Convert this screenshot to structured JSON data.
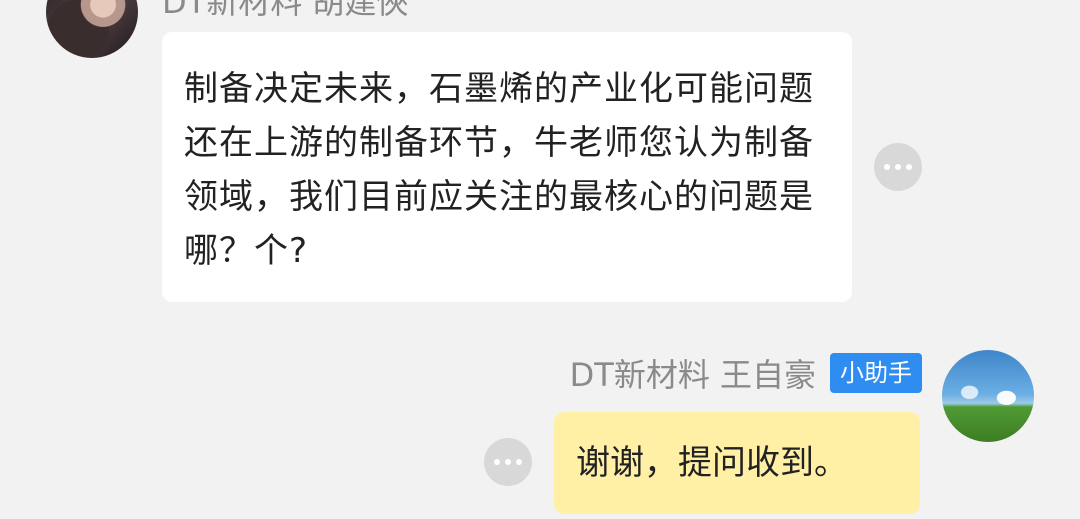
{
  "messages": [
    {
      "sender": "DT新材料 胡建俠",
      "text": "制备决定未来，石墨烯的产业化可能问题还在上游的制备环节，牛老师您认为制备领域，我们目前应关注的最核心的问题是哪？个?",
      "avatar_icon": "user-avatar-photo",
      "more_icon": "more-horizontal-icon"
    },
    {
      "sender": "DT新材料 王自豪",
      "badge": "小助手",
      "text": "谢谢，提问收到。",
      "avatar_icon": "landscape-avatar",
      "more_icon": "more-horizontal-icon"
    }
  ],
  "colors": {
    "background": "#f2f2f2",
    "incoming_bubble": "#ffffff",
    "outgoing_bubble": "#fff0a6",
    "badge": "#2f8cf0",
    "sender_text": "#8a8a8a",
    "message_text": "#222222"
  }
}
